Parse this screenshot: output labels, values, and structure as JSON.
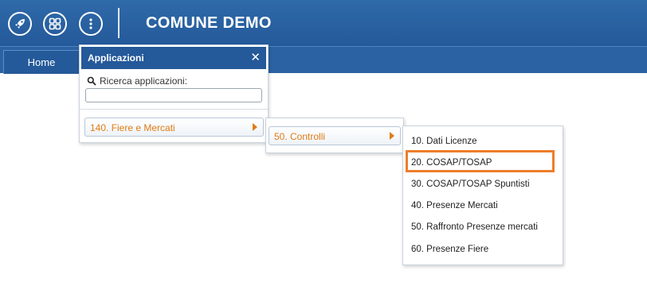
{
  "header": {
    "title": "COMUNE DEMO",
    "buttons": [
      {
        "icon": "rocket-icon"
      },
      {
        "icon": "grid-icon"
      },
      {
        "icon": "more-vertical-icon"
      }
    ]
  },
  "tabs": [
    {
      "label": "Home"
    }
  ],
  "applications": {
    "title": "Applicazioni",
    "close_glyph": "✕",
    "search_label": "Ricerca applicazioni:",
    "search_value": "",
    "items": [
      {
        "label": "140. Fiere e Mercati"
      }
    ]
  },
  "submenu_1": {
    "items": [
      {
        "label": "50. Controlli"
      }
    ]
  },
  "submenu_2": {
    "items": [
      {
        "label": "10. Dati Licenze"
      },
      {
        "label": "20. COSAP/TOSAP",
        "highlighted": true
      },
      {
        "label": "30. COSAP/TOSAP Spuntisti"
      },
      {
        "label": "40. Presenze Mercati"
      },
      {
        "label": "50. Raffronto Presenze mercati"
      },
      {
        "label": "60. Presenze Fiere"
      }
    ]
  },
  "colors": {
    "header_bg": "#2a62a3",
    "accent_orange": "#e07b16",
    "highlight_border": "#ee7d2a"
  }
}
